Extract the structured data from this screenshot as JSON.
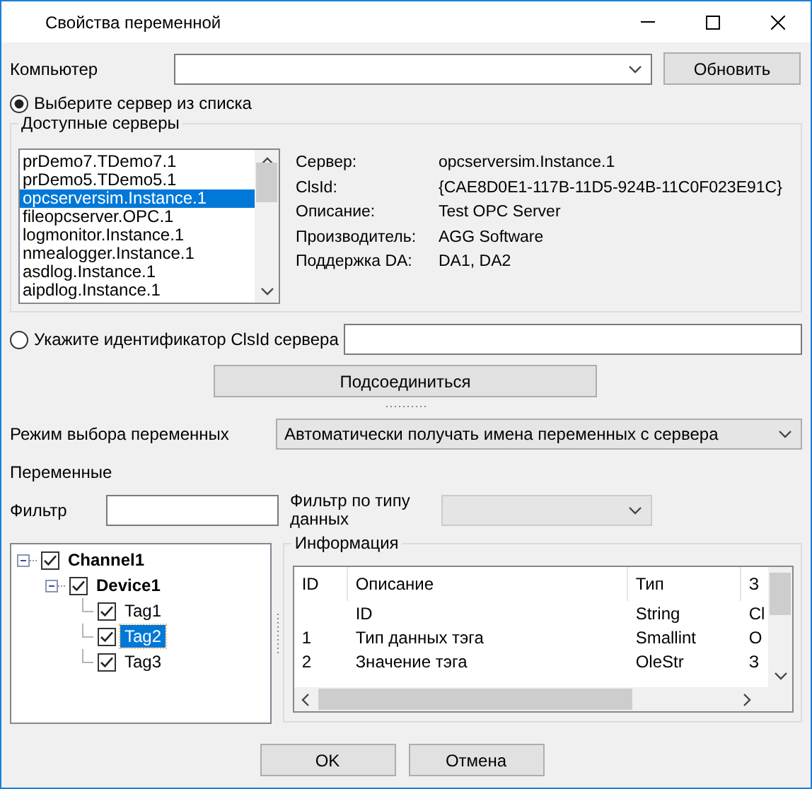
{
  "window": {
    "title": "Свойства переменной"
  },
  "computer": {
    "label": "Компьютер",
    "button": "Обновить"
  },
  "from_list": {
    "label": "Выберите сервер из списка",
    "selected": true
  },
  "servers": {
    "title": "Доступные серверы",
    "items": [
      {
        "label": "prDemo7.TDemo7.1",
        "selected": false
      },
      {
        "label": "prDemo5.TDemo5.1",
        "selected": false
      },
      {
        "label": "opcserversim.Instance.1",
        "selected": true
      },
      {
        "label": "fileopcserver.OPC.1",
        "selected": false
      },
      {
        "label": "logmonitor.Instance.1",
        "selected": false
      },
      {
        "label": "nmealogger.Instance.1",
        "selected": false
      },
      {
        "label": "asdlog.Instance.1",
        "selected": false
      },
      {
        "label": "aipdlog.Instance.1",
        "selected": false
      }
    ],
    "info": [
      {
        "label": "Сервер:",
        "value": "opcserversim.Instance.1"
      },
      {
        "label": "ClsId:",
        "value": "{CAE8D0E1-117B-11D5-924B-11C0F023E91C}"
      },
      {
        "label": "Описание:",
        "value": "Test OPC Server"
      },
      {
        "label": "Производитель:",
        "value": "AGG Software"
      },
      {
        "label": "Поддержка DA:",
        "value": "DA1, DA2"
      }
    ]
  },
  "by_clsid": {
    "label": "Укажите идентификатор ClsId сервера",
    "selected": false
  },
  "connect_button": "Подсоединиться",
  "mode": {
    "label": "Режим выбора переменных",
    "value": "Автоматически получать имена переменных с сервера"
  },
  "variables_label": "Переменные",
  "filter": {
    "label": "Фильтр"
  },
  "type_filter": {
    "label": "Фильтр по типу данных",
    "disabled": true
  },
  "tree": [
    {
      "label": "Channel1",
      "checked": true,
      "expanded": true,
      "selected": false,
      "children": [
        {
          "label": "Device1",
          "checked": true,
          "expanded": true,
          "selected": false,
          "children": [
            {
              "label": "Tag1",
              "checked": true,
              "selected": false
            },
            {
              "label": "Tag2",
              "checked": true,
              "selected": true
            },
            {
              "label": "Tag3",
              "checked": true,
              "selected": false
            }
          ]
        }
      ]
    }
  ],
  "info": {
    "title": "Информация",
    "columns": [
      "ID",
      "Описание",
      "Тип",
      "З"
    ],
    "rows": [
      [
        "",
        "ID",
        "String",
        "Cl"
      ],
      [
        "1",
        "Тип данных тэга",
        "Smallint",
        "O"
      ],
      [
        "2",
        "Значение тэга",
        "OleStr",
        "З"
      ]
    ]
  },
  "buttons": [
    "OK",
    "Отмена"
  ]
}
